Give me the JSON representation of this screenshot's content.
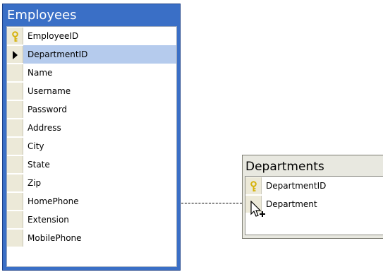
{
  "employees": {
    "title": "Employees",
    "columns": [
      {
        "label": "EmployeeID",
        "icon": "key-icon"
      },
      {
        "label": "DepartmentID",
        "icon": "row-pointer-icon",
        "selected": true
      },
      {
        "label": "Name"
      },
      {
        "label": "Username"
      },
      {
        "label": "Password"
      },
      {
        "label": "Address"
      },
      {
        "label": "City"
      },
      {
        "label": "State"
      },
      {
        "label": "Zip"
      },
      {
        "label": "HomePhone"
      },
      {
        "label": "Extension"
      },
      {
        "label": "MobilePhone"
      }
    ]
  },
  "departments": {
    "title": "Departments",
    "columns": [
      {
        "label": "DepartmentID",
        "icon": "key-icon"
      },
      {
        "label": "Department"
      }
    ]
  },
  "colors": {
    "selected_table": "#3a6fc6",
    "selected_row": "#b5cbed",
    "key": "#d6b20c"
  }
}
